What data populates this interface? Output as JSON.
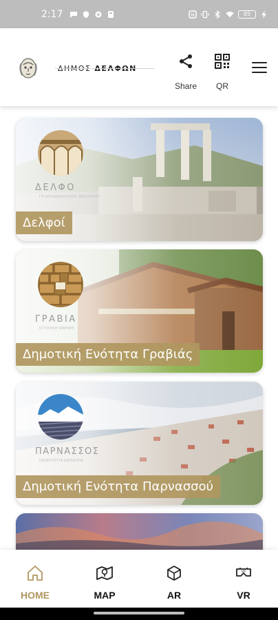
{
  "status_bar": {
    "time": "2:17",
    "battery": "85"
  },
  "header": {
    "logo_text_light": "ΔΗΜΟΣ",
    "logo_text_bold": "ΔΕΛΦΩΝ",
    "share_label": "Share",
    "qr_label": "QR"
  },
  "cards": [
    {
      "label": "Δελφοί",
      "emblem_text": "ΔΕΛΦΟ",
      "emblem_sub": "ΓΗ ΑΡΧΑΙΟΛΟΓΙΚΟΥ ΘΗΣΑΥΡΟΥ"
    },
    {
      "label": "Δημοτική Ενότητα Γραβιάς",
      "emblem_text": "ΓΡΑΒΙΑ",
      "emblem_sub": "ΙΣΤΟΡΙΚΗ ΜΝΗΜΗ"
    },
    {
      "label": "Δημοτική Ενότητα Παρνασσού",
      "emblem_text": "ΠΑΡΝΑΣΣΟΣ",
      "emblem_sub": "ΚΑΙΝΟΥΡΓΙΑ ΕΜΠΕΙΡΙΑ"
    },
    {
      "label": ""
    }
  ],
  "bottom_nav": {
    "home": "HOME",
    "map": "MAP",
    "ar": "AR",
    "vr": "VR",
    "active": "home"
  },
  "colors": {
    "accent": "#b0965f",
    "label_bg": "#b09760",
    "status_bar": "#bdbdbd"
  },
  "icons": [
    "share-icon",
    "qr-icon",
    "menu-icon",
    "home-icon",
    "map-icon",
    "ar-cube-icon",
    "vr-headset-icon"
  ]
}
